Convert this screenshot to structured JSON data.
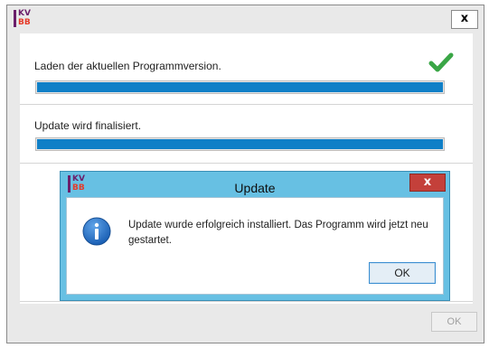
{
  "window": {
    "logo_top": "KV",
    "logo_bottom": "BB",
    "close_label": "x"
  },
  "steps": [
    {
      "label": "Laden der aktuellen Programmversion.",
      "progress": 1.0,
      "done": true
    },
    {
      "label": "Update wird finalisiert.",
      "progress": 1.0,
      "done": false
    }
  ],
  "footer": {
    "ok_label": "OK"
  },
  "dialog": {
    "title": "Update",
    "close_label": "x",
    "logo_top": "KV",
    "logo_bottom": "BB",
    "message": "Update wurde erfolgreich installiert. Das Programm wird jetzt neu gestartet.",
    "ok_label": "OK"
  },
  "colors": {
    "progress_fill": "#0f7fc7",
    "dialog_frame": "#67c0e3",
    "dialog_close": "#c4403a",
    "check": "#3aa646",
    "logo_purple": "#6b1f6b",
    "logo_red": "#e53b2a"
  },
  "icons": {
    "success": "checkmark-icon",
    "info": "info-icon"
  }
}
